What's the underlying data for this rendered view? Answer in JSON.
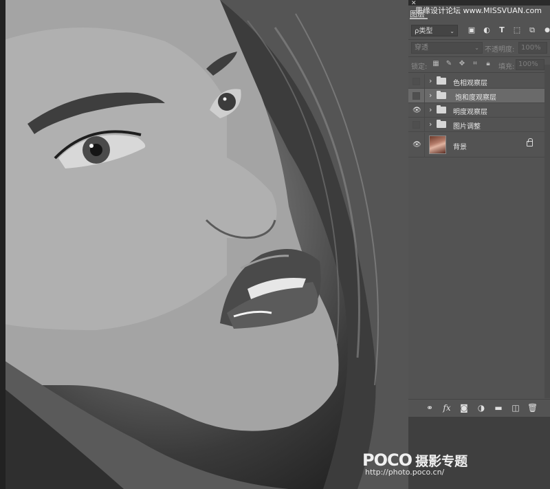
{
  "watermark_top": "思缘设计论坛 www.MISSVUAN.com",
  "panel": {
    "close_label": "✕",
    "tab_title": "图层"
  },
  "filter": {
    "type_label": "ρ类型",
    "icons": [
      "image-filter-icon",
      "adjustment-filter-icon",
      "type-filter-icon",
      "shape-filter-icon",
      "smart-object-filter-icon"
    ]
  },
  "blend": {
    "mode": "穿透",
    "opacity_label": "不透明度:",
    "opacity_value": "100%"
  },
  "lock": {
    "label": "锁定:",
    "fill_label": "填充:",
    "fill_value": "100%"
  },
  "layers": [
    {
      "name": "色相观察层",
      "visible": false,
      "selected": false
    },
    {
      "name": "饱和度观察层",
      "visible": false,
      "selected": true
    },
    {
      "name": "明度观察层",
      "visible": true,
      "selected": false
    },
    {
      "name": "图片调整",
      "visible": false,
      "selected": false
    }
  ],
  "background_layer": {
    "name": "背景",
    "visible": true,
    "locked": true
  },
  "bottom_icons": [
    "link-icon",
    "fx-icon",
    "mask-icon",
    "adjustment-icon",
    "group-folder-icon",
    "new-layer-icon",
    "trash-icon"
  ],
  "fx_label": "fx",
  "watermark_bottom": {
    "brand": "POCO",
    "subtitle": "摄影专题",
    "url": "http://photo.poco.cn/"
  }
}
